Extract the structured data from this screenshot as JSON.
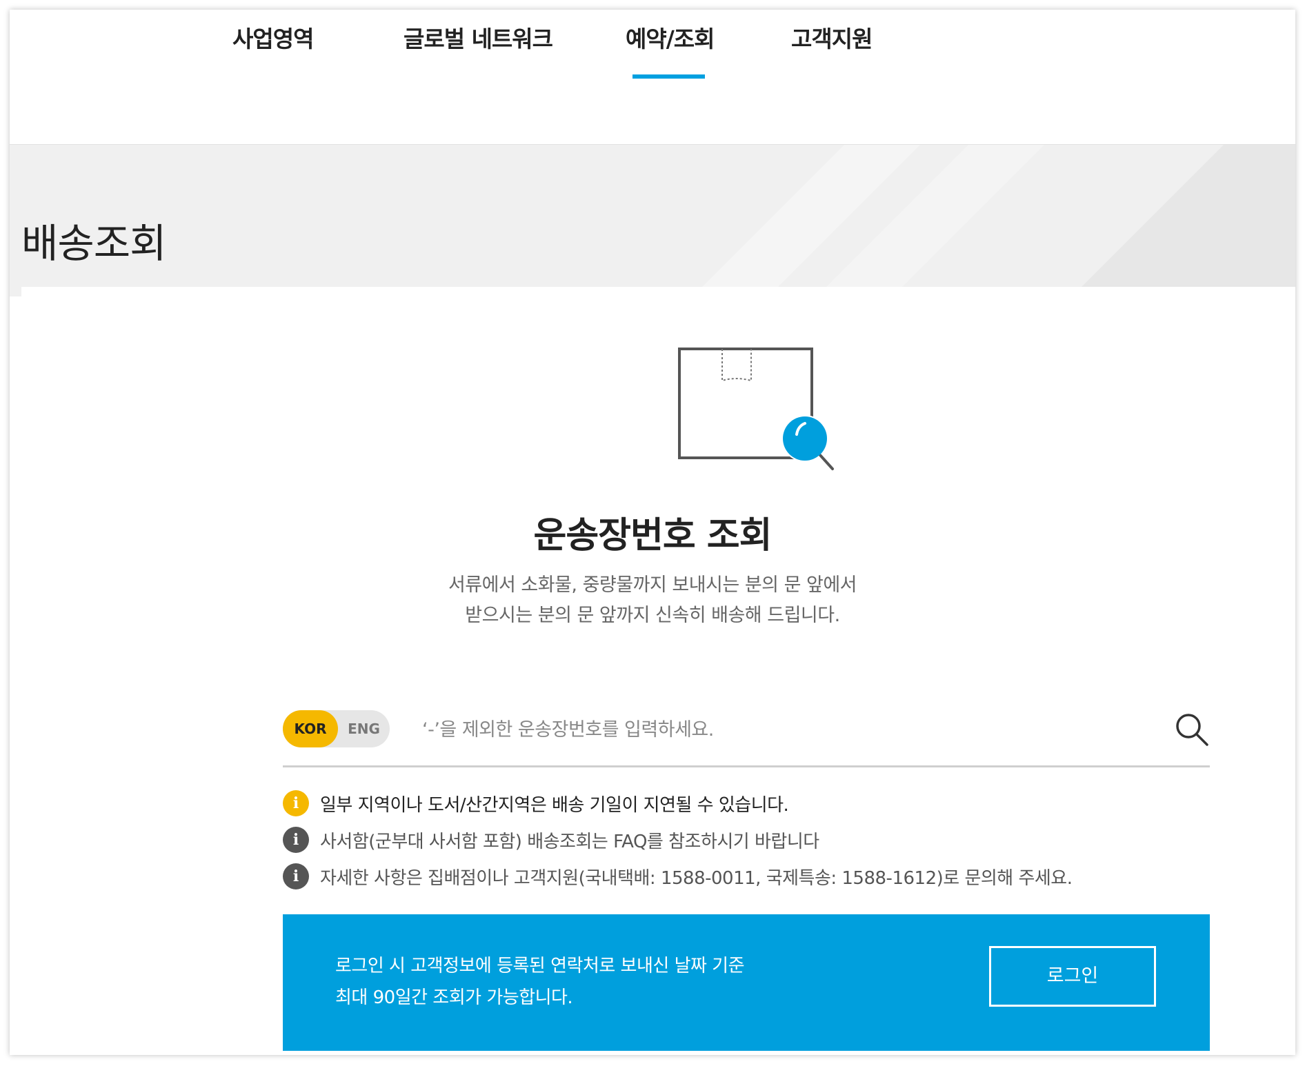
{
  "nav": {
    "items": [
      {
        "label": "사업영역"
      },
      {
        "label": "글로벌 네트워크"
      },
      {
        "label": "예약/조회"
      },
      {
        "label": "고객지원"
      }
    ],
    "active": "예약/조회"
  },
  "page": {
    "title": "배송조회"
  },
  "tracking": {
    "heading": "운송장번호 조회",
    "description_line1": "서류에서 소화물, 중량물까지 보내시는 분의 문 앞에서",
    "description_line2": "받으시는 분의 문 앞까지 신속히 배송해 드립니다."
  },
  "search": {
    "lang_kor": "KOR",
    "lang_eng": "ENG",
    "lang_selected": "KOR",
    "placeholder": "‘-’을 제외한 운송장번호를 입력하세요.",
    "value": ""
  },
  "notices": [
    {
      "icon": "info-icon",
      "text": "일부 지역이나 도서/산간지역은 배송 기일이 지연될 수 있습니다.",
      "color": "#f5b800"
    },
    {
      "icon": "info-icon",
      "text": "사서함(군부대 사서함 포함) 배송조회는 FAQ를 참조하시기 바랍니다",
      "color": "#555555"
    },
    {
      "icon": "info-icon",
      "text": "자세한 사항은 집배점이나 고객지원(국내택배: 1588-0011, 국제특송: 1588-1612)로 문의해 주세요.",
      "color": "#555555"
    }
  ],
  "login_banner": {
    "line1": "로그인 시 고객정보에 등록된 연락처로 보내신 날짜 기준",
    "line2": "최대 90일간 조회가 가능합니다.",
    "button_label": "로그인"
  },
  "colors": {
    "accent_blue": "#009fdd",
    "accent_yellow": "#f5b800",
    "nav_underline": "#00a0e0"
  }
}
